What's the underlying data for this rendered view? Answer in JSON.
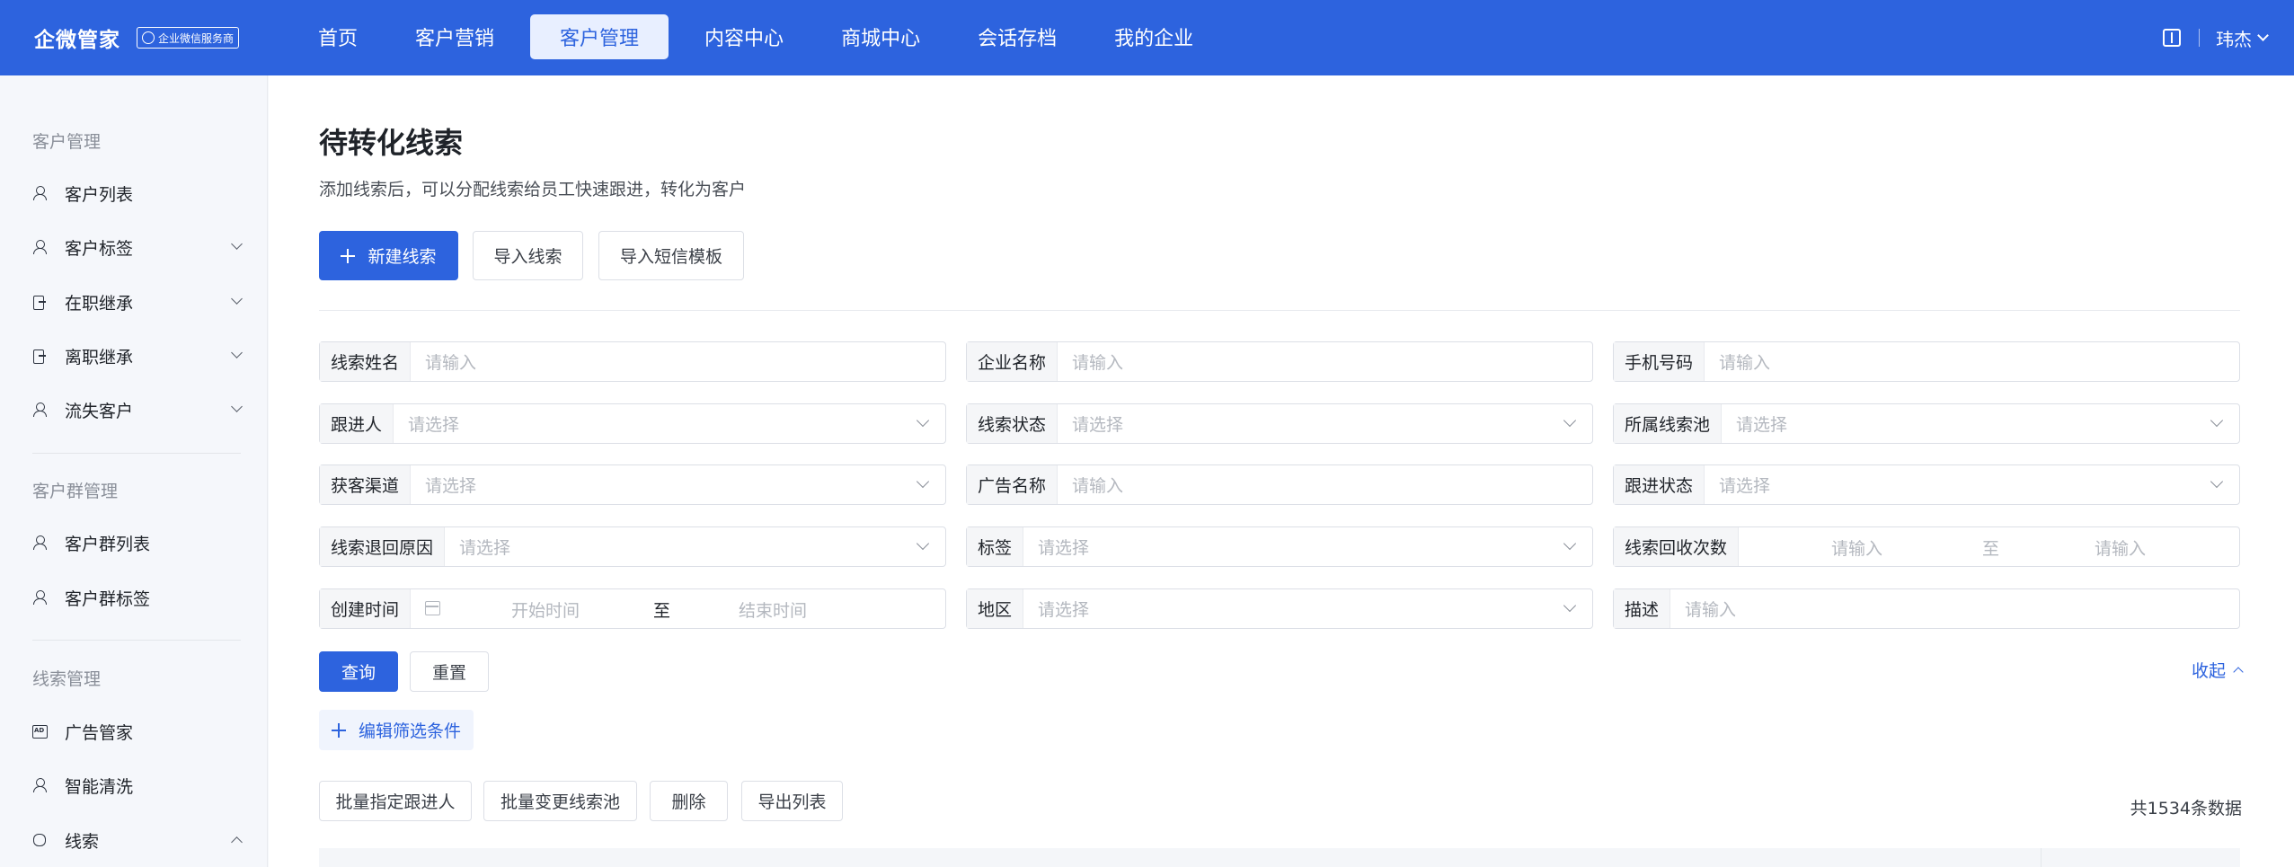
{
  "topbar": {
    "brand": "企微管家",
    "badge": "企业微信服务商",
    "nav": [
      {
        "label": "首页",
        "active": false
      },
      {
        "label": "客户营销",
        "active": false
      },
      {
        "label": "客户管理",
        "active": true
      },
      {
        "label": "内容中心",
        "active": false
      },
      {
        "label": "商城中心",
        "active": false
      },
      {
        "label": "会话存档",
        "active": false
      },
      {
        "label": "我的企业",
        "active": false
      }
    ],
    "user": "玮杰"
  },
  "sidebar": {
    "groups": [
      "客户管理",
      "客户群管理",
      "线索管理"
    ],
    "items": [
      {
        "label": "客户列表",
        "icon": "user-icon"
      },
      {
        "label": "客户标签",
        "icon": "user-icon"
      },
      {
        "label": "在职继承",
        "icon": "door-icon"
      },
      {
        "label": "离职继承",
        "icon": "door-icon"
      },
      {
        "label": "流失客户",
        "icon": "user-icon"
      },
      {
        "label": "客户群列表",
        "icon": "user-icon"
      },
      {
        "label": "客户群标签",
        "icon": "user-icon"
      },
      {
        "label": "广告管家",
        "icon": "ad-icon"
      },
      {
        "label": "智能清洗",
        "icon": "user-icon"
      },
      {
        "label": "线索",
        "icon": "link-icon"
      }
    ]
  },
  "main": {
    "title": "待转化线索",
    "desc": "添加线索后，可以分配线索给员工快速跟进，转化为客户",
    "actions": {
      "new": "新建线索",
      "import": "导入线索",
      "import_sms": "导入短信模板"
    },
    "filters": {
      "name": {
        "label": "线索姓名",
        "placeholder": "请输入"
      },
      "company": {
        "label": "企业名称",
        "placeholder": "请输入"
      },
      "phone": {
        "label": "手机号码",
        "placeholder": "请输入"
      },
      "follower": {
        "label": "跟进人",
        "placeholder": "请选择"
      },
      "status": {
        "label": "线索状态",
        "placeholder": "请选择"
      },
      "pool": {
        "label": "所属线索池",
        "placeholder": "请选择"
      },
      "channel": {
        "label": "获客渠道",
        "placeholder": "请选择"
      },
      "ad": {
        "label": "广告名称",
        "placeholder": "请输入"
      },
      "follow_status": {
        "label": "跟进状态",
        "placeholder": "请选择"
      },
      "return_reason": {
        "label": "线索退回原因",
        "placeholder": "请选择"
      },
      "tag": {
        "label": "标签",
        "placeholder": "请选择"
      },
      "recycle": {
        "label": "线索回收次数",
        "from": "请输入",
        "to": "至",
        "end": "请输入"
      },
      "created": {
        "label": "创建时间",
        "start": "开始时间",
        "to": "至",
        "end": "结束时间"
      },
      "region": {
        "label": "地区",
        "placeholder": "请选择"
      },
      "desc": {
        "label": "描述",
        "placeholder": "请输入"
      }
    },
    "query": "查询",
    "reset": "重置",
    "collapse": "收起",
    "edit_filter": "编辑筛选条件",
    "batch": {
      "assign": "批量指定跟进人",
      "change_pool": "批量变更线索池",
      "delete": "删除",
      "export": "导出列表"
    },
    "total": "共1534条数据"
  }
}
